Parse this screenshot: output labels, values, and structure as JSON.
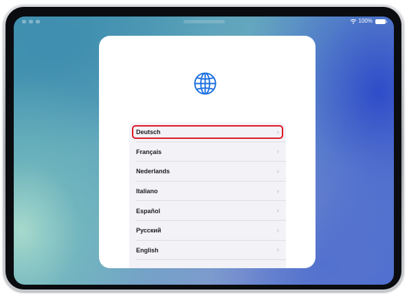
{
  "status_bar": {
    "battery_text": "100%"
  },
  "setup": {
    "language_list": [
      {
        "label": "Deutsch",
        "selected": true
      },
      {
        "label": "Français"
      },
      {
        "label": "Nederlands"
      },
      {
        "label": "Italiano"
      },
      {
        "label": "Español"
      },
      {
        "label": "Русский"
      },
      {
        "label": "English"
      },
      {
        "label": ""
      }
    ]
  },
  "icons": {
    "globe": "globe-icon",
    "chevron": "chevron-right-icon",
    "wifi": "wifi-icon",
    "battery": "battery-icon"
  },
  "colors": {
    "selection_outline": "#e01622",
    "globe_blue": "#1a6fe0",
    "list_background": "#f2f2f7",
    "chevron": "#b4b4bb"
  }
}
